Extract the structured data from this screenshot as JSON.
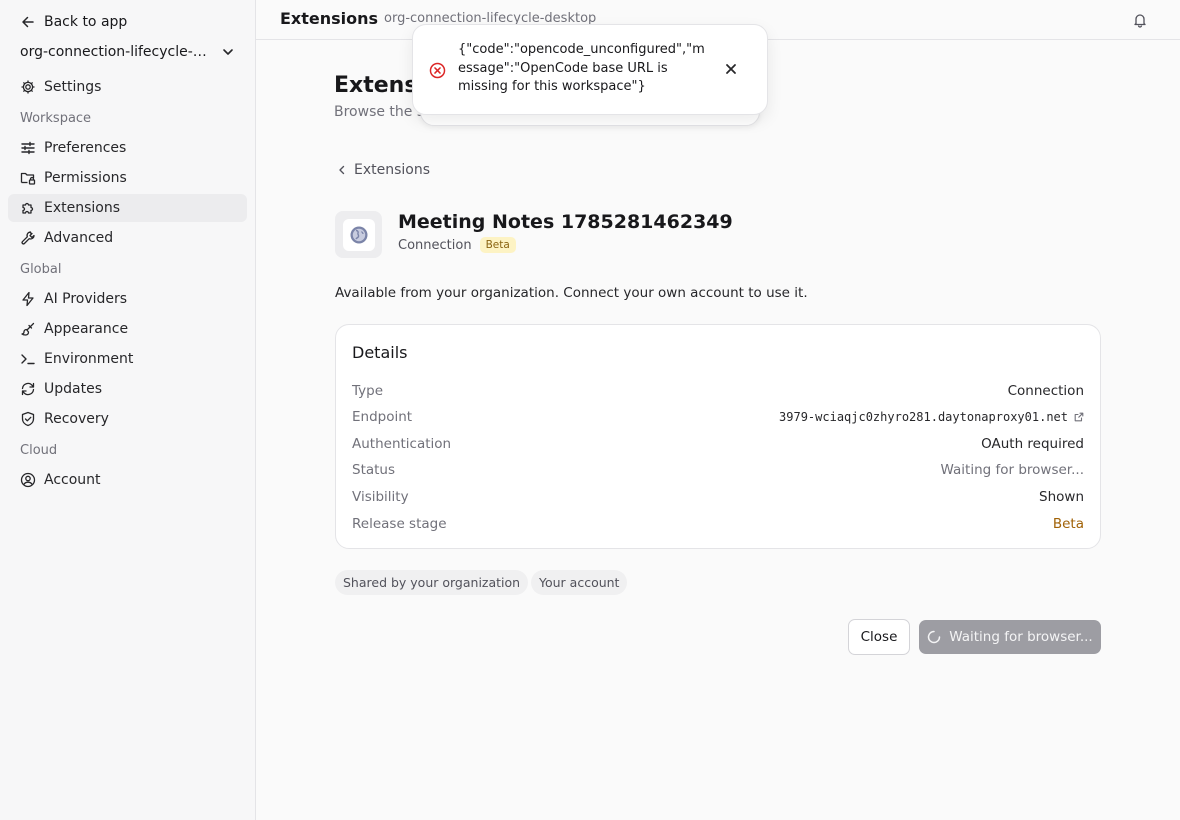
{
  "sidebar": {
    "back_label": "Back to app",
    "workspace_name": "org-connection-lifecycle-desktop",
    "settings_label": "Settings",
    "sections": {
      "workspace": "Workspace",
      "global": "Global",
      "cloud": "Cloud"
    },
    "items": {
      "preferences": "Preferences",
      "permissions": "Permissions",
      "extensions": "Extensions",
      "advanced": "Advanced",
      "ai_providers": "AI Providers",
      "appearance": "Appearance",
      "environment": "Environment",
      "updates": "Updates",
      "recovery": "Recovery",
      "account": "Account"
    },
    "active_item": "extensions"
  },
  "topbar": {
    "title": "Extensions",
    "subtitle": "org-connection-lifecycle-desktop"
  },
  "main": {
    "heading": "Extensi",
    "subheading": "Browse the s",
    "breadcrumb": "Extensions",
    "extension": {
      "name": "Meeting Notes 1785281462349",
      "type": "Connection",
      "badge": "Beta",
      "icon": "globe-icon"
    },
    "availability": "Available from your organization. Connect your own account to use it.",
    "details": {
      "title": "Details",
      "rows": [
        {
          "label": "Type",
          "value": "Connection"
        },
        {
          "label": "Endpoint",
          "value": "3979-wciaqjc0zhyro281.daytonaproxy01.net"
        },
        {
          "label": "Authentication",
          "value": "OAuth required"
        },
        {
          "label": "Status",
          "value": "Waiting for browser..."
        },
        {
          "label": "Visibility",
          "value": "Shown"
        },
        {
          "label": "Release stage",
          "value": "Beta"
        }
      ]
    },
    "chips": [
      "Shared by your organization",
      "Your account"
    ],
    "buttons": {
      "close": "Close",
      "waiting": "Waiting for browser..."
    }
  },
  "toast": {
    "message": "{\"code\":\"opencode_unconfigured\",\"message\":\"OpenCode base URL is missing for this workspace\"}",
    "color": "#dc2626"
  }
}
